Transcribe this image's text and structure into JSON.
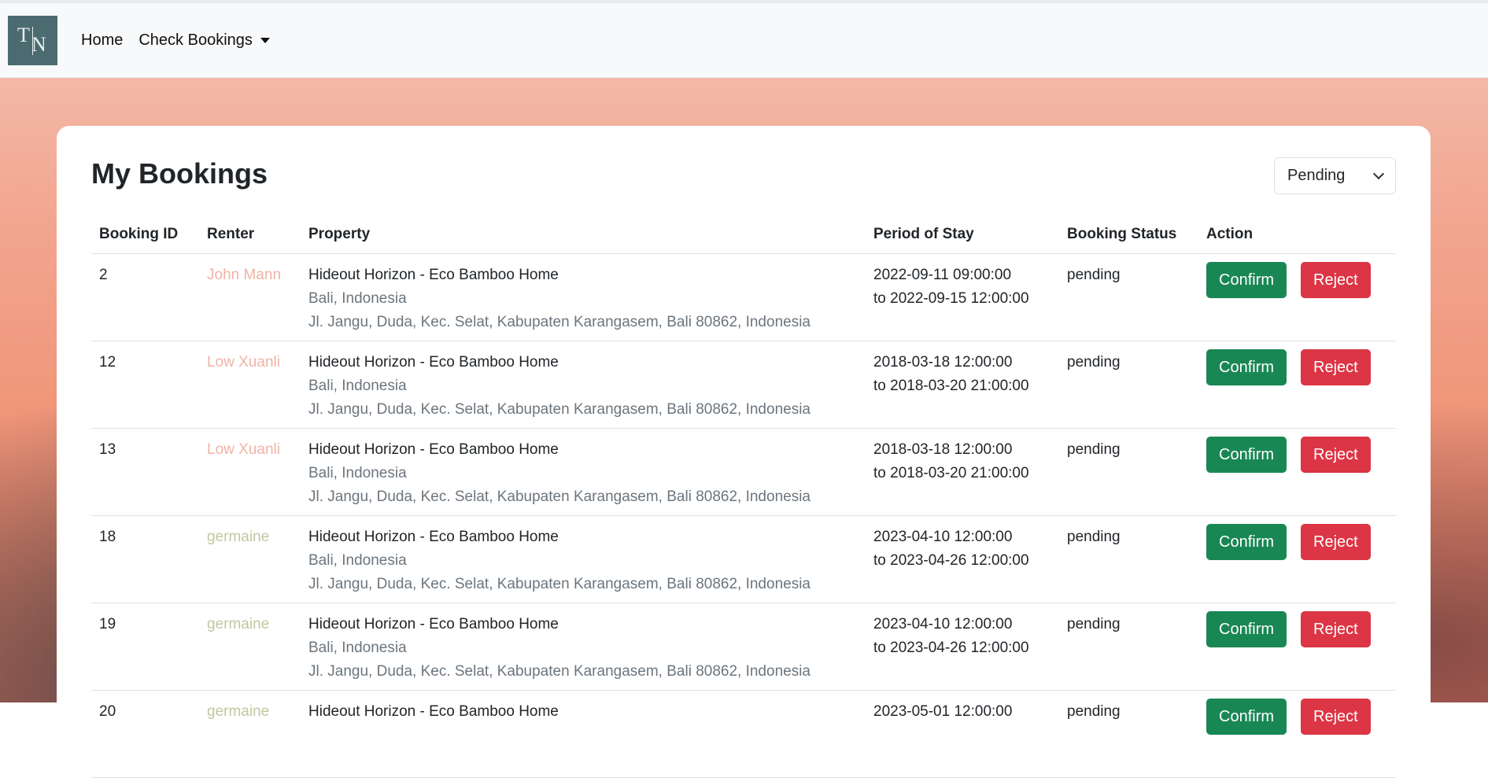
{
  "nav": {
    "logo_letter_1": "T",
    "logo_letter_2": "N",
    "home": "Home",
    "check_bookings": "Check Bookings"
  },
  "page": {
    "title": "My Bookings",
    "status_filter": "Pending"
  },
  "table": {
    "headers": [
      "Booking ID",
      "Renter",
      "Property",
      "Period of Stay",
      "Booking Status",
      "Action"
    ],
    "confirm_label": "Confirm",
    "reject_label": "Reject",
    "rows": [
      {
        "id": "2",
        "renter": "John Mann",
        "renter_color": "#f0b3a5",
        "property": "Hideout Horizon - Eco Bamboo Home",
        "location": "Bali, Indonesia",
        "address": "Jl. Jangu, Duda, Kec. Selat, Kabupaten Karangasem, Bali 80862, Indonesia",
        "from": "2022-09-11 09:00:00",
        "to": "to 2022-09-15 12:00:00",
        "status": "pending"
      },
      {
        "id": "12",
        "renter": "Low Xuanli",
        "renter_color": "#f0b3a5",
        "property": "Hideout Horizon - Eco Bamboo Home",
        "location": "Bali, Indonesia",
        "address": "Jl. Jangu, Duda, Kec. Selat, Kabupaten Karangasem, Bali 80862, Indonesia",
        "from": "2018-03-18 12:00:00",
        "to": "to 2018-03-20 21:00:00",
        "status": "pending"
      },
      {
        "id": "13",
        "renter": "Low Xuanli",
        "renter_color": "#f0b3a5",
        "property": "Hideout Horizon - Eco Bamboo Home",
        "location": "Bali, Indonesia",
        "address": "Jl. Jangu, Duda, Kec. Selat, Kabupaten Karangasem, Bali 80862, Indonesia",
        "from": "2018-03-18 12:00:00",
        "to": "to 2018-03-20 21:00:00",
        "status": "pending"
      },
      {
        "id": "18",
        "renter": "germaine",
        "renter_color": "#c2c7a0",
        "property": "Hideout Horizon - Eco Bamboo Home",
        "location": "Bali, Indonesia",
        "address": "Jl. Jangu, Duda, Kec. Selat, Kabupaten Karangasem, Bali 80862, Indonesia",
        "from": "2023-04-10 12:00:00",
        "to": "to 2023-04-26 12:00:00",
        "status": "pending"
      },
      {
        "id": "19",
        "renter": "germaine",
        "renter_color": "#c2c7a0",
        "property": "Hideout Horizon - Eco Bamboo Home",
        "location": "Bali, Indonesia",
        "address": "Jl. Jangu, Duda, Kec. Selat, Kabupaten Karangasem, Bali 80862, Indonesia",
        "from": "2023-04-10 12:00:00",
        "to": "to 2023-04-26 12:00:00",
        "status": "pending"
      },
      {
        "id": "20",
        "renter": "germaine",
        "renter_color": "#c2c7a0",
        "property": "Hideout Horizon - Eco Bamboo Home",
        "location": "",
        "address": "",
        "from": "2023-05-01 12:00:00",
        "to": "",
        "status": "pending"
      }
    ]
  }
}
